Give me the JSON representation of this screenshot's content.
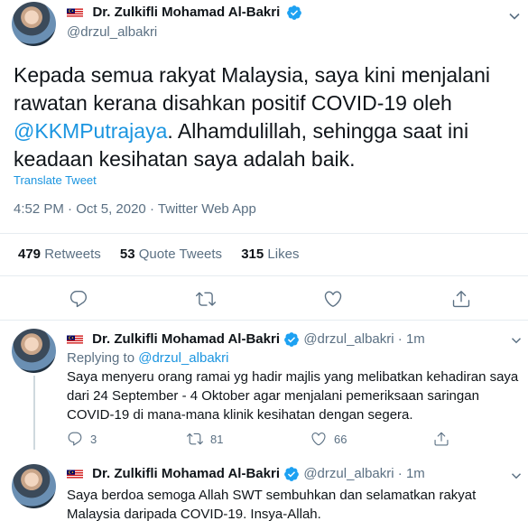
{
  "main_tweet": {
    "author_name": "Dr. Zulkifli Mohamad Al-Bakri",
    "handle": "@drzul_albakri",
    "text_before_link": "Kepada semua rakyat Malaysia, saya kini  menjalani rawatan kerana disahkan positif COVID-19 oleh ",
    "mention": "@KKMPutrajaya",
    "text_after_link": ". Alhamdulillah, sehingga saat ini keadaan kesihatan saya adalah baik.",
    "translate": "Translate Tweet",
    "time": "4:52 PM",
    "date": "Oct 5, 2020",
    "source": "Twitter Web App",
    "dot": "·",
    "stats": {
      "retweets_count": "479",
      "retweets_label": "Retweets",
      "quote_count": "53",
      "quote_label": "Quote Tweets",
      "likes_count": "315",
      "likes_label": "Likes"
    }
  },
  "replies": [
    {
      "author_name": "Dr. Zulkifli Mohamad Al-Bakri",
      "handle": "@drzul_albakri",
      "dot": "·",
      "age": "1m",
      "replying_prefix": "Replying to ",
      "replying_to": "@drzul_albakri",
      "text": "Saya menyeru orang ramai yg hadir majlis yang melibatkan kehadiran saya dari 24 September - 4 Oktober agar menjalani pemeriksaan saringan COVID-19 di mana-mana klinik kesihatan dengan segera.",
      "reply_count": "3",
      "retweet_count": "81",
      "like_count": "66"
    },
    {
      "author_name": "Dr. Zulkifli Mohamad Al-Bakri",
      "handle": "@drzul_albakri",
      "dot": "·",
      "age": "1m",
      "text": "Saya berdoa semoga Allah SWT sembuhkan dan selamatkan rakyat Malaysia daripada COVID-19. Insya-Allah."
    }
  ],
  "colors": {
    "accent": "#1b95e0",
    "muted": "#5b7083",
    "divider": "#e6ecf0"
  },
  "icons": [
    "malaysia-flag",
    "verified-badge",
    "reply-icon",
    "retweet-icon",
    "like-icon",
    "share-icon",
    "chevron-down-icon"
  ]
}
